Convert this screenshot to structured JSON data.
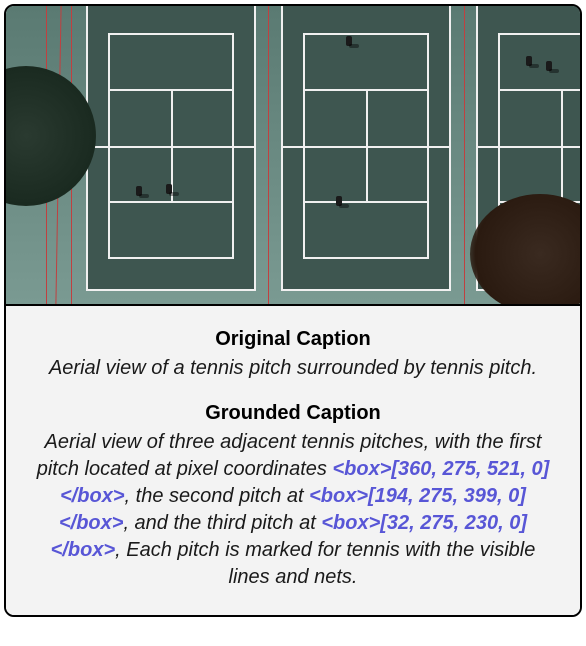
{
  "original": {
    "title": "Original Caption",
    "text": "Aerial view of a tennis pitch surrounded by tennis pitch."
  },
  "grounded": {
    "title": "Grounded Caption",
    "pre": "Aerial view of three adjacent tennis pitches, with the first pitch located at pixel coordinates ",
    "box1": "<box>[360, 275, 521, 0]</box>",
    "mid1": ", the second pitch at ",
    "box2": "<box>[194, 275, 399, 0]</box>",
    "mid2": ", and the third pitch at ",
    "box3": "<box>[32, 275, 230, 0]</box>",
    "post": ", Each pitch is marked for tennis with the visible lines and nets."
  }
}
